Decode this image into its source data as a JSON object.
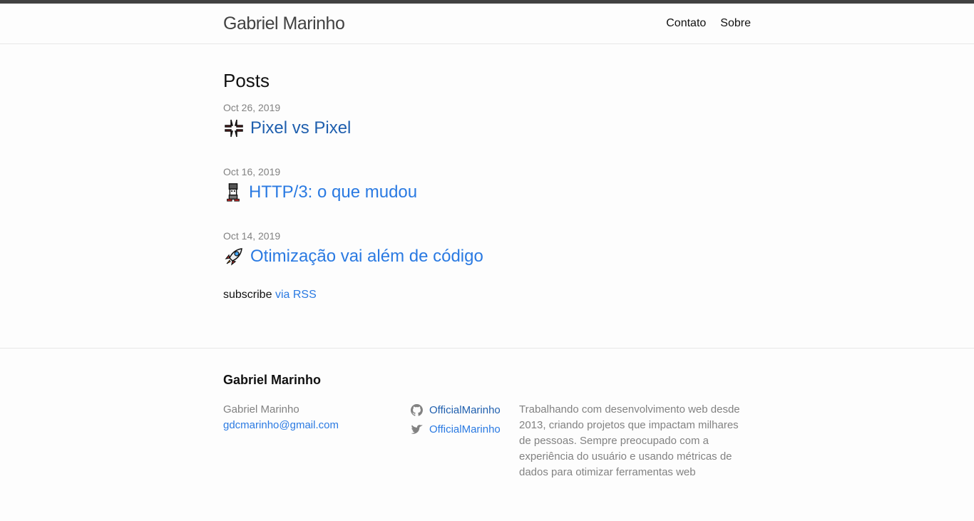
{
  "header": {
    "site_title": "Gabriel Marinho",
    "nav": [
      {
        "label": "Contato"
      },
      {
        "label": "Sobre"
      }
    ]
  },
  "main": {
    "heading": "Posts",
    "posts": [
      {
        "date": "Oct 26, 2019",
        "title": "Pixel vs Pixel",
        "icon": "anger-emoji-icon"
      },
      {
        "date": "Oct 16, 2019",
        "title": "HTTP/3: o que mudou",
        "icon": "sheriff-robot-emoji-icon"
      },
      {
        "date": "Oct 14, 2019",
        "title": "Otimização vai além de código",
        "icon": "rocket-emoji-icon"
      }
    ],
    "subscribe_prefix": "subscribe",
    "subscribe_link": "via RSS"
  },
  "footer": {
    "heading": "Gabriel Marinho",
    "name": "Gabriel Marinho",
    "email": "gdcmarinho@gmail.com",
    "social": [
      {
        "icon": "github-icon",
        "label": "OfficialMarinho"
      },
      {
        "icon": "twitter-icon",
        "label": "OfficialMarinho"
      }
    ],
    "description": "Trabalhando com desenvolvimento web desde 2013, criando projetos que impactam milhares de pessoas. Sempre preocupado com a experiência do usuário e usando métricas de dados para otimizar ferramentas web"
  },
  "colors": {
    "link": "#2a7ae2",
    "visited_link": "#1f5fae",
    "muted": "#828282",
    "top_bar": "#424242"
  }
}
